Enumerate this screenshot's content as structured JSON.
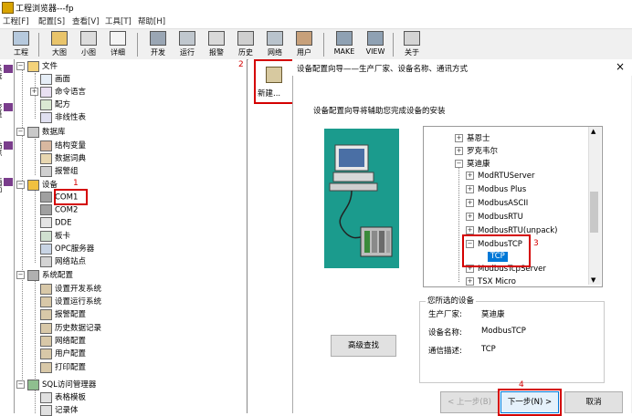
{
  "window": {
    "title": "工程浏览器---fp"
  },
  "menubar": {
    "items": [
      "工程[F]",
      "配置[S]",
      "查看[V]",
      "工具[T]",
      "帮助[H]"
    ]
  },
  "toolbar": {
    "buttons": [
      {
        "label": "工程",
        "icon": "project-icon"
      },
      {
        "label": "大图",
        "icon": "large-icons-icon"
      },
      {
        "label": "小图",
        "icon": "small-icons-icon"
      },
      {
        "label": "详细",
        "icon": "details-icon"
      },
      {
        "label": "开发",
        "icon": "develop-icon"
      },
      {
        "label": "运行",
        "icon": "run-icon"
      },
      {
        "label": "报警",
        "icon": "alarm-icon"
      },
      {
        "label": "历史",
        "icon": "history-icon"
      },
      {
        "label": "网络",
        "icon": "network-icon"
      },
      {
        "label": "用户",
        "icon": "user-icon"
      },
      {
        "label": "MAKE",
        "icon": "make-icon"
      },
      {
        "label": "VIEW",
        "icon": "view-icon"
      },
      {
        "label": "关于",
        "icon": "about-icon"
      }
    ]
  },
  "vtabs": [
    "系统",
    "变量",
    "站点",
    "画面"
  ],
  "tree": {
    "nodes": [
      {
        "label": "文件",
        "icon": "folder-icon",
        "level": 0,
        "expander": "−"
      },
      {
        "label": "画面",
        "icon": "screen-icon",
        "level": 1
      },
      {
        "label": "命令语言",
        "icon": "command-language-icon",
        "level": 1,
        "expander": "+"
      },
      {
        "label": "配方",
        "icon": "recipe-icon",
        "level": 1
      },
      {
        "label": "非线性表",
        "icon": "nonlinear-table-icon",
        "level": 1
      },
      {
        "label": "数据库",
        "icon": "database-icon",
        "level": 0,
        "expander": "−"
      },
      {
        "label": "结构变量",
        "icon": "struct-variable-icon",
        "level": 1
      },
      {
        "label": "数据词典",
        "icon": "data-dictionary-icon",
        "level": 1
      },
      {
        "label": "报警组",
        "icon": "alarm-group-icon",
        "level": 1
      },
      {
        "label": "设备",
        "icon": "device-icon",
        "level": 0,
        "expander": "−"
      },
      {
        "label": "COM1",
        "icon": "com-port-icon",
        "level": 1
      },
      {
        "label": "COM2",
        "icon": "com-port-icon",
        "level": 1
      },
      {
        "label": "DDE",
        "icon": "dde-icon",
        "level": 1
      },
      {
        "label": "板卡",
        "icon": "board-card-icon",
        "level": 1
      },
      {
        "label": "OPC服务器",
        "icon": "opc-server-icon",
        "level": 1
      },
      {
        "label": "网络站点",
        "icon": "network-station-icon",
        "level": 1
      },
      {
        "label": "系统配置",
        "icon": "system-config-icon",
        "level": 0,
        "expander": "−"
      },
      {
        "label": "设置开发系统",
        "icon": "dev-system-icon",
        "level": 1
      },
      {
        "label": "设置运行系统",
        "icon": "run-system-icon",
        "level": 1
      },
      {
        "label": "报警配置",
        "icon": "alarm-config-icon",
        "level": 1
      },
      {
        "label": "历史数据记录",
        "icon": "history-record-icon",
        "level": 1
      },
      {
        "label": "网络配置",
        "icon": "network-config-icon",
        "level": 1
      },
      {
        "label": "用户配置",
        "icon": "user-config-icon",
        "level": 1
      },
      {
        "label": "打印配置",
        "icon": "print-config-icon",
        "level": 1
      },
      {
        "label": "SQL访问管理器",
        "icon": "sql-manager-icon",
        "level": 0,
        "expander": "−"
      },
      {
        "label": "表格模板",
        "icon": "table-template-icon",
        "level": 1
      },
      {
        "label": "记录体",
        "icon": "record-icon",
        "level": 1
      }
    ]
  },
  "new_button": {
    "label": "新建..."
  },
  "annotations": [
    "1",
    "2",
    "3",
    "4"
  ],
  "wizard": {
    "title": "设备配置向导——生产厂家、设备名称、通讯方式",
    "close": "×",
    "intro": "设备配置向导将辅助您完成设备的安装",
    "list": [
      {
        "label": "基恩士",
        "level": 1,
        "expander": "+"
      },
      {
        "label": "罗克韦尔",
        "level": 1,
        "expander": "+"
      },
      {
        "label": "莫迪康",
        "level": 1,
        "expander": "−"
      },
      {
        "label": "ModRTUServer",
        "level": 2,
        "expander": "+"
      },
      {
        "label": "Modbus Plus",
        "level": 2,
        "expander": "+"
      },
      {
        "label": "ModbusASCII",
        "level": 2,
        "expander": "+"
      },
      {
        "label": "ModbusRTU",
        "level": 2,
        "expander": "+"
      },
      {
        "label": "ModbusRTU(unpack)",
        "level": 2,
        "expander": "+"
      },
      {
        "label": "ModbusTCP",
        "level": 2,
        "expander": "−"
      },
      {
        "label": "TCP",
        "level": 3,
        "selected": true
      },
      {
        "label": "ModbusTcpServer",
        "level": 2,
        "expander": "+"
      },
      {
        "label": "TSX Micro",
        "level": 2,
        "expander": "+"
      }
    ],
    "selected_group": {
      "title": "您所选的设备",
      "rows": [
        {
          "key": "生产厂家:",
          "value": "莫迪康"
        },
        {
          "key": "设备名称:",
          "value": "ModbusTCP"
        },
        {
          "key": "通信描述:",
          "value": "TCP"
        }
      ]
    },
    "buttons": {
      "advanced": "高级查找",
      "back": "< 上一步(B)",
      "next": "下一步(N) >",
      "cancel": "取消"
    }
  },
  "colors": {
    "highlight_red": "#d40000",
    "selection": "#0078d7",
    "illustration_bg": "#1b9b8d"
  }
}
